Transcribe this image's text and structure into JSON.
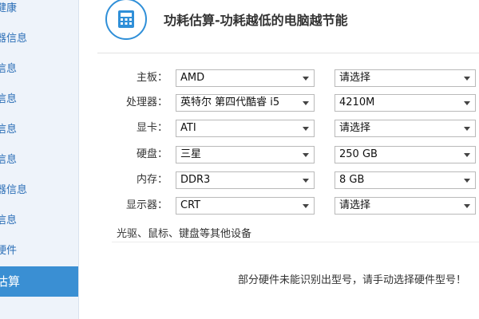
{
  "sidebar": {
    "items": [
      {
        "label": "健康"
      },
      {
        "label": "器信息"
      },
      {
        "label": "信息"
      },
      {
        "label": "信息"
      },
      {
        "label": "信息"
      },
      {
        "label": "信息"
      },
      {
        "label": "器信息"
      },
      {
        "label": "信息"
      },
      {
        "label": "硬件"
      },
      {
        "label": "估算",
        "active": true
      }
    ]
  },
  "header": {
    "icon": "calculator-icon",
    "title": "功耗估算-功耗越低的电脑越节能"
  },
  "form": {
    "rows": [
      {
        "label": "主板：",
        "brand": "AMD",
        "model": "请选择"
      },
      {
        "label": "处理器：",
        "brand": "英特尔 第四代酷睿 i5",
        "model": "4210M"
      },
      {
        "label": "显卡：",
        "brand": "ATI",
        "model": "请选择"
      },
      {
        "label": "硬盘：",
        "brand": "三星",
        "model": "250 GB"
      },
      {
        "label": "内存：",
        "brand": "DDR3",
        "model": "8 GB"
      },
      {
        "label": "显示器：",
        "brand": "CRT",
        "model": "请选择"
      }
    ],
    "extra_devices": "光驱、鼠标、键盘等其他设备"
  },
  "notice": "部分硬件未能识别出型号，请手动选择硬件型号！",
  "colors": {
    "accent": "#3a8fd3",
    "sidebar_bg": "#eef3fa",
    "sidebar_text": "#2c6fb7"
  }
}
